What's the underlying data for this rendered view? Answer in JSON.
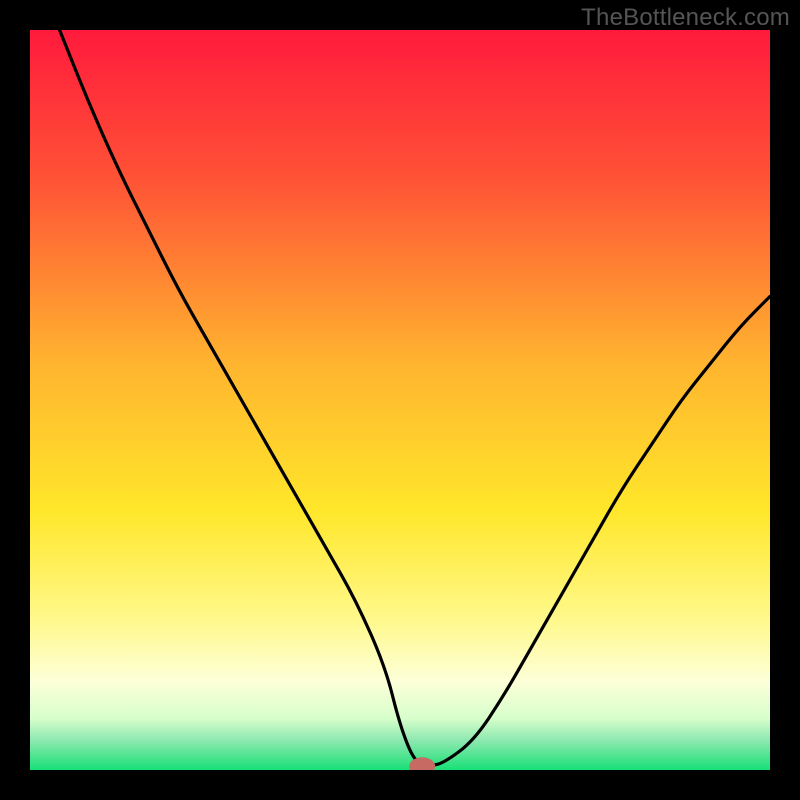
{
  "watermark": "TheBottleneck.com",
  "chart_data": {
    "type": "line",
    "title": "",
    "xlabel": "",
    "ylabel": "",
    "xlim": [
      0,
      100
    ],
    "ylim": [
      0,
      100
    ],
    "series": [
      {
        "name": "bottleneck-curve",
        "x": [
          4,
          8,
          12,
          16,
          20,
          24,
          28,
          32,
          36,
          40,
          44,
          48,
          50,
          52,
          54,
          56,
          60,
          64,
          68,
          72,
          76,
          80,
          84,
          88,
          92,
          96,
          100
        ],
        "y": [
          100,
          90,
          81,
          73,
          65,
          58,
          51,
          44,
          37,
          30,
          23,
          14,
          6,
          1,
          0.5,
          1,
          4,
          10,
          17,
          24,
          31,
          38,
          44,
          50,
          55,
          60,
          64
        ]
      }
    ],
    "marker": {
      "x": 53,
      "y": 0.5,
      "color": "#c76a63"
    },
    "gradient_stops": [
      {
        "offset": 0,
        "color": "#ff1a3c"
      },
      {
        "offset": 20,
        "color": "#ff5236"
      },
      {
        "offset": 45,
        "color": "#ffb42f"
      },
      {
        "offset": 65,
        "color": "#ffe72a"
      },
      {
        "offset": 80,
        "color": "#fff98e"
      },
      {
        "offset": 88,
        "color": "#fdffd8"
      },
      {
        "offset": 93,
        "color": "#d7ffcb"
      },
      {
        "offset": 96,
        "color": "#8de8b0"
      },
      {
        "offset": 100,
        "color": "#18e076"
      }
    ],
    "frame_color": "#000000"
  }
}
